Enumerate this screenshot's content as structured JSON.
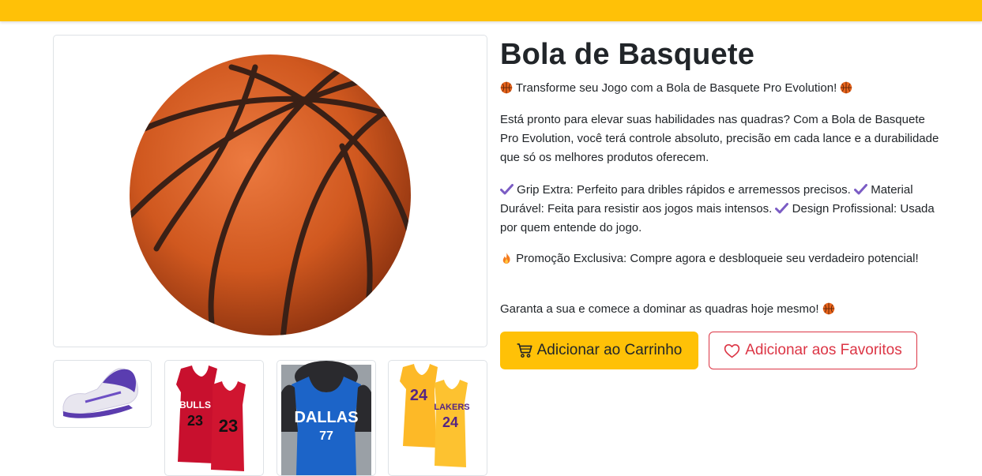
{
  "header": {
    "color": "#ffc107"
  },
  "gallery": {
    "main_image": {
      "icon": "basketball-image"
    },
    "thumbnails": [
      {
        "icon": "sneaker-image"
      },
      {
        "icon": "bulls-jersey-image"
      },
      {
        "icon": "mavericks-jersey-image"
      },
      {
        "icon": "lakers-jersey-image"
      }
    ]
  },
  "product": {
    "title": "Bola de Basquete",
    "tagline": "Transforme seu Jogo com a Bola de Basquete Pro Evolution!",
    "intro": "Está pronto para elevar suas habilidades nas quadras? Com a Bola de Basquete Pro Evolution, você terá controle absoluto, precisão em cada lance e a durabilidade que só os melhores produtos oferecem.",
    "features": [
      "Grip Extra: Perfeito para dribles rápidos e arremessos precisos.",
      "Material Durável: Feita para resistir aos jogos mais intensos.",
      "Design Profissional: Usada por quem entende do jogo."
    ],
    "promo": "Promoção Exclusiva: Compre agora e desbloqueie seu verdadeiro potencial!",
    "closing": "Garanta a sua e comece a dominar as quadras hoje mesmo!"
  },
  "actions": {
    "add_to_cart": "Adicionar ao Carrinho",
    "add_to_favorites": "Adicionar aos Favoritos"
  },
  "colors": {
    "accent": "#ffc107",
    "danger": "#dc3545",
    "check": "#7b5cc4"
  }
}
